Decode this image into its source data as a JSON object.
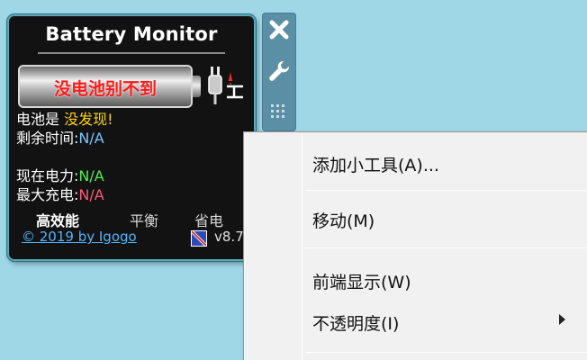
{
  "gadget": {
    "title": "Battery Monitor",
    "battery_status": "没电池别不到",
    "lines": {
      "battery_label": "电池是",
      "battery_value": "没发现!",
      "remaining_label": "剩余时间:",
      "remaining_value": "N/A",
      "current_power_label": "现在电力:",
      "current_power_value": "N/A",
      "max_charge_label": "最大充电:",
      "max_charge_value": "N/A"
    },
    "modes": [
      "高效能",
      "平衡",
      "省电"
    ],
    "copyright": "© 2019 by Igogo",
    "version": "v8.7"
  },
  "toolbar": {
    "close_icon": "close-icon",
    "options_icon": "wrench-icon",
    "drag_icon": "drag-grip-icon"
  },
  "context_menu": {
    "items": [
      {
        "label": "添加小工具(A)..."
      },
      {
        "label": "移动(M)"
      },
      {
        "label": "前端显示(W)"
      },
      {
        "label": "不透明度(I)",
        "submenu": true
      }
    ]
  },
  "colors": {
    "desktop": "#9fd7e7",
    "gadget_bg": "#121212",
    "toolbar": "#5b8fa6",
    "menu_bg": "#f1f1f1",
    "status_red": "#ff1a1a",
    "value_yellow": "#ffd400",
    "value_blue": "#78c8ff",
    "value_green": "#4ef04e",
    "value_red": "#ff5a7a",
    "link_blue": "#4fb4ff"
  }
}
